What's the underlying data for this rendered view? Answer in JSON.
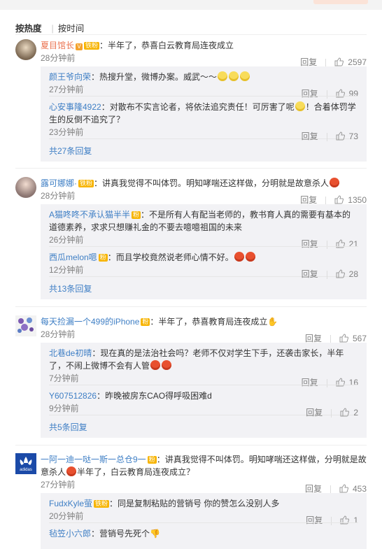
{
  "sort": {
    "hot": "按热度",
    "time": "按时间"
  },
  "comments": [
    {
      "name": "夏目馆长",
      "text": "：半年了，恭喜白云教育局连夜成立",
      "time": "28分钟前",
      "reply": "回复",
      "likes": "2597",
      "replies": [
        {
          "name": "颜王爷向荣",
          "text": "：热搜升堂，微博办案。威武～～",
          "time": "27分钟前",
          "reply": "回复",
          "likes": "99"
        },
        {
          "name": "心安事隆4922",
          "text": "：对散布不实言论者，将依法追究责任！可厉害了呢",
          "text2": "！合着体罚学生的反倒不追究了？",
          "time": "23分钟前",
          "reply": "回复",
          "likes": "73"
        }
      ],
      "more": "共27条回复"
    },
    {
      "name": "露可娜娜·",
      "text": "：讲真我觉得不叫体罚。明知哮喘还这样做，分明就是故意杀人",
      "time": "28分钟前",
      "reply": "回复",
      "likes": "1350",
      "replies": [
        {
          "name": "A猫咚咚不承认猫半半",
          "text": "：不是所有人有配当老师的，教书育人真的需要有基本的道德素养，求求只想赚礼金的不要去噫噫祖国的未来",
          "time": "26分钟前",
          "reply": "回复",
          "likes": "21"
        },
        {
          "name": "西瓜melon嗯",
          "text": "：而且学校竟然说老师心情不好。",
          "time": "12分钟前",
          "reply": "回复",
          "likes": "28"
        }
      ],
      "more": "共13条回复"
    },
    {
      "name": "每天捡漏一个499的iPhone",
      "text": "：半年了，恭喜教育局连夜成立",
      "time": "28分钟前",
      "reply": "回复",
      "likes": "567",
      "replies": [
        {
          "name": "北巷de初晴",
          "text": "：现在真的是法治社会吗？老师不仅对学生下手，还袭击家长，半年了，不闹上微博不会有人管",
          "time": "7分钟前",
          "reply": "回复",
          "likes": "16"
        },
        {
          "name": "Y607512826",
          "text": "：昨晚被房东CAO得呼吸困难d",
          "time": "9分钟前",
          "reply": "回复",
          "likes": "2"
        }
      ],
      "more": "共5条回复"
    },
    {
      "name": "一阿一迪一哒一斯一总仓9一",
      "text": "：讲真我觉得不叫体罚。明知哮喘还这样做，分明就是故意杀人",
      "text2": "半年了，白云教育局连夜成立？",
      "time": "27分钟前",
      "reply": "回复",
      "likes": "453",
      "replies": [
        {
          "name": "FudxKyle萤",
          "text": "：同是复制粘贴的营销号 你的赞怎么没别人多",
          "time": "20分钟前",
          "reply": "回复",
          "likes": "1"
        },
        {
          "name": "毡笠小六郎",
          "text": "：营销号先死个"
        }
      ]
    }
  ],
  "colors": {
    "name": "#eb7350",
    "link": "#3f7fc5",
    "meta": "#808080",
    "reply_bg": "#f2f2f5"
  }
}
